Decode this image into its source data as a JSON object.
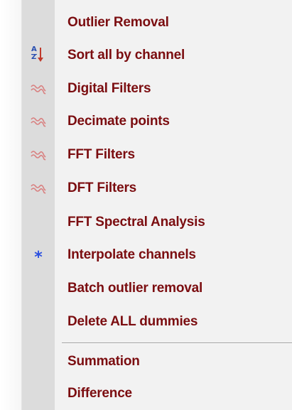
{
  "menu": {
    "items": [
      {
        "label": "Outlier Removal",
        "icon": "none"
      },
      {
        "label": "Sort all by channel",
        "icon": "sort-az-icon"
      },
      {
        "label": "Digital Filters",
        "icon": "wave-filter-icon"
      },
      {
        "label": "Decimate points",
        "icon": "wave-filter-icon"
      },
      {
        "label": "FFT Filters",
        "icon": "wave-filter-icon"
      },
      {
        "label": "DFT Filters",
        "icon": "wave-filter-icon"
      },
      {
        "label": "FFT Spectral Analysis",
        "icon": "none"
      },
      {
        "label": "Interpolate channels",
        "icon": "asterisk-icon"
      },
      {
        "label": "Batch outlier removal",
        "icon": "none"
      },
      {
        "label": "Delete ALL dummies",
        "icon": "none"
      },
      {
        "label": "Summation",
        "icon": "none"
      },
      {
        "label": "Difference",
        "icon": "none"
      }
    ],
    "sort_icon": {
      "top": "A",
      "bottom": "Z"
    },
    "asterisk_glyph": "*"
  },
  "colors": {
    "label": "#7b0d10",
    "gutter": "#dcdcdc",
    "menu_bg": "#f2f2f2",
    "wave_icon": "#d98080",
    "asterisk": "#2a4fe0",
    "sort_letters": "#2a4fb0",
    "sort_arrow": "#c0392b"
  }
}
